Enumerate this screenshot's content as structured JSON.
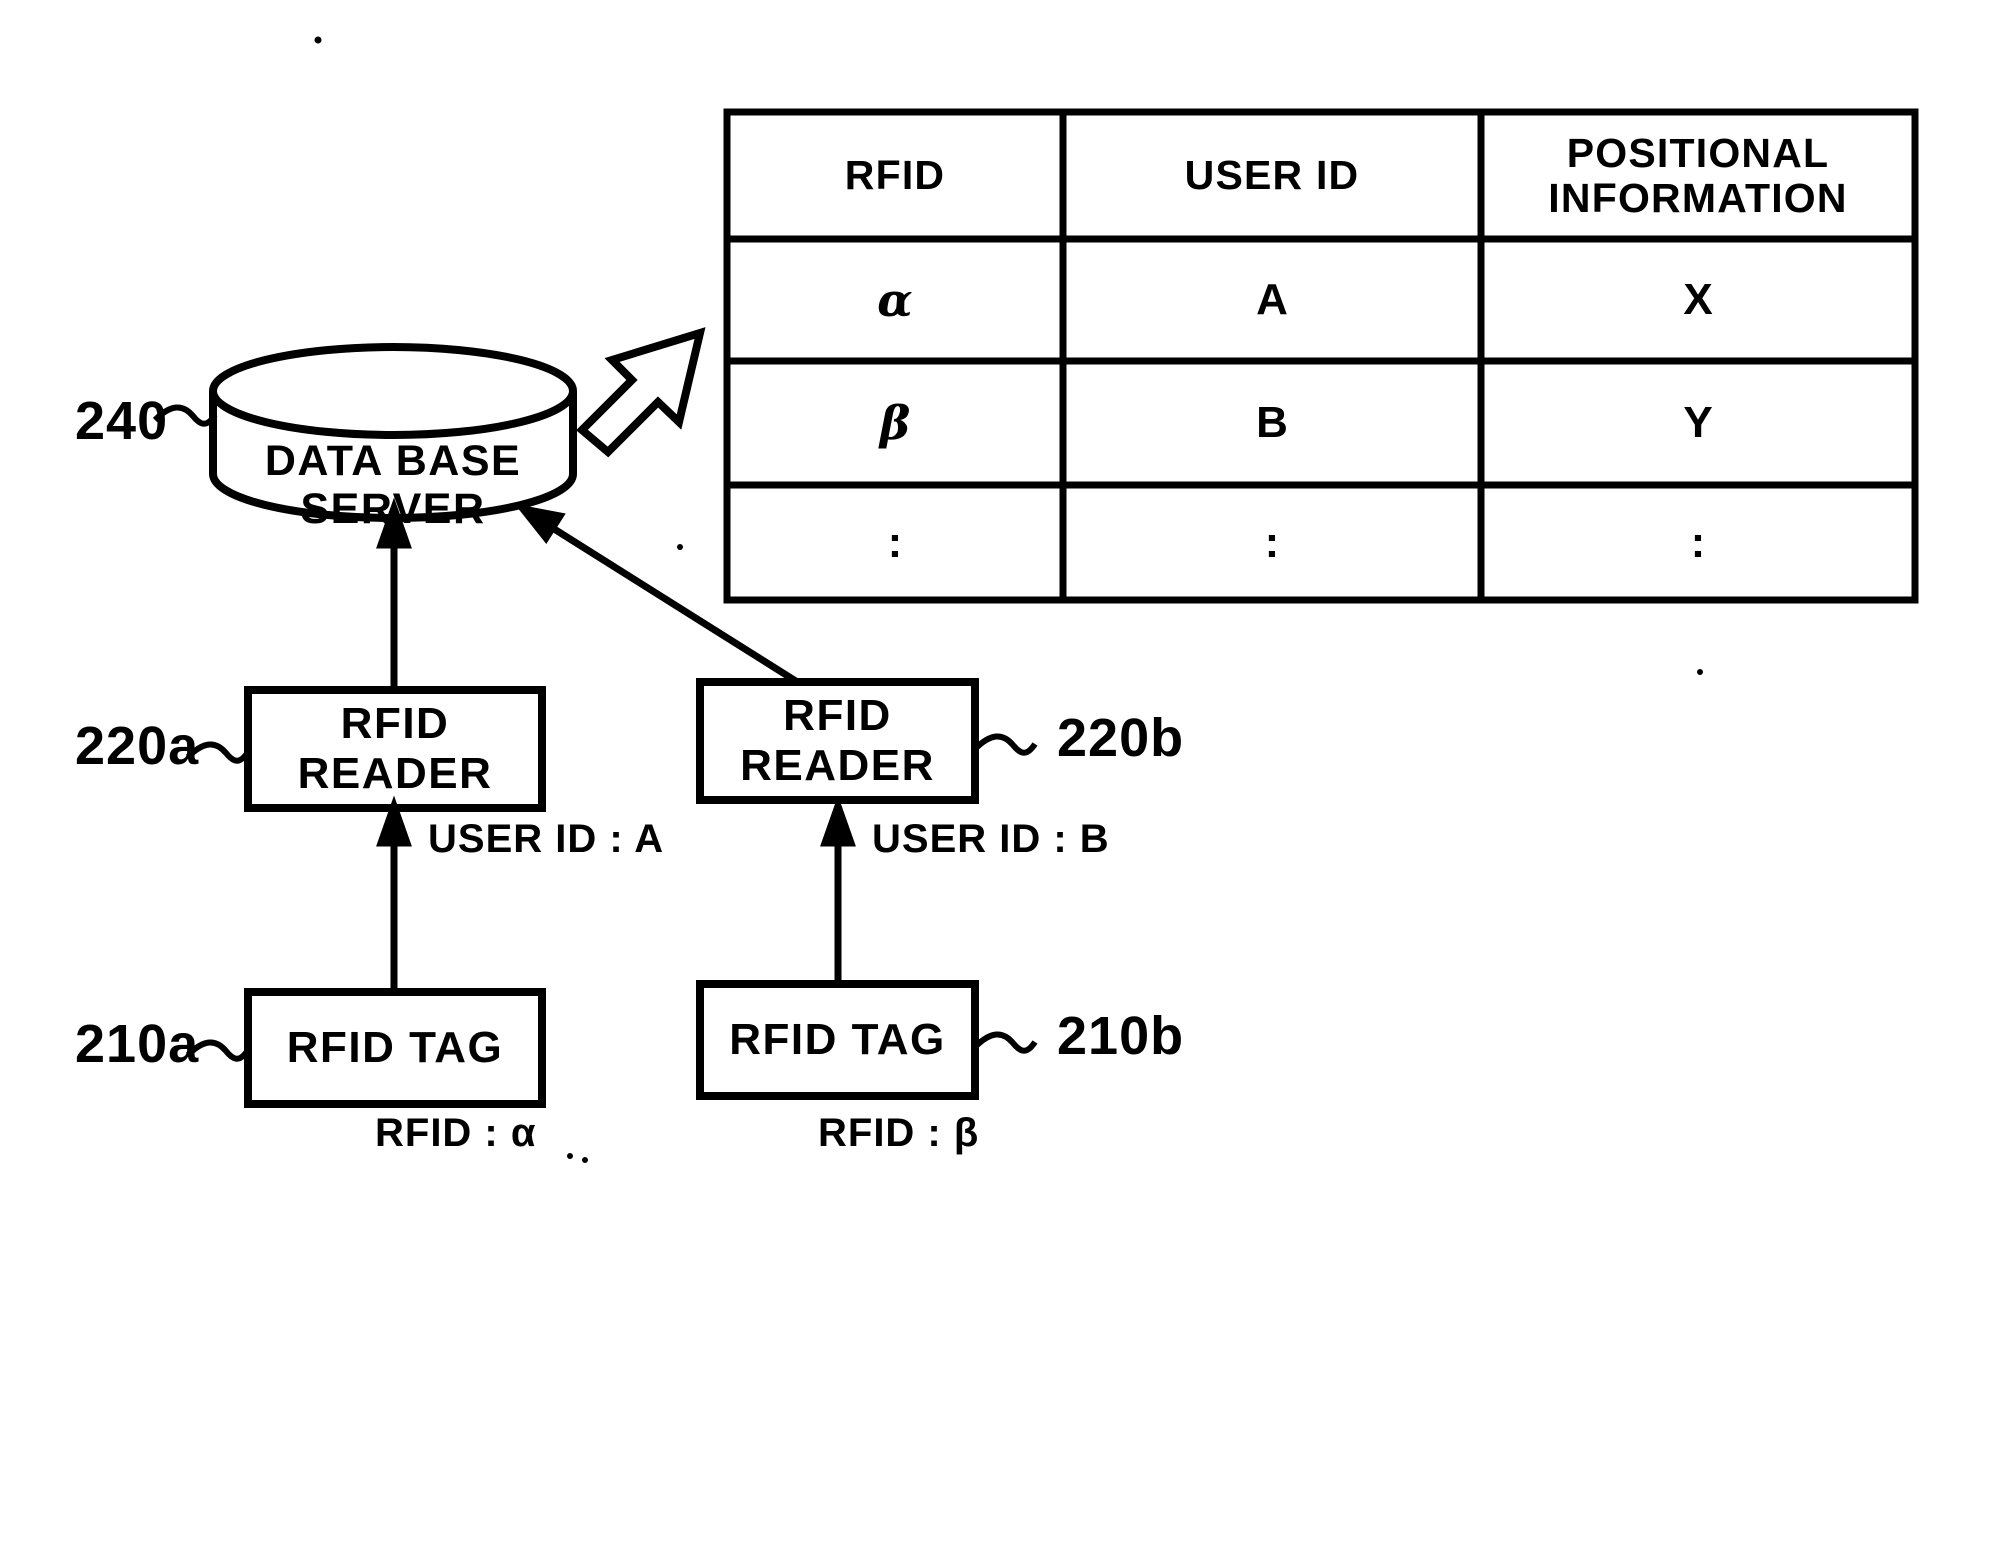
{
  "figure": {
    "kind": "patent-diagram",
    "ink_color": "#000000",
    "background_color": "#ffffff"
  },
  "table": {
    "headers": [
      "RFID",
      "USER ID",
      "POSITIONAL\nINFORMATION"
    ],
    "header_rfid": "RFID",
    "header_user_id": "USER ID",
    "header_positional_line1": "POSITIONAL",
    "header_positional_line2": "INFORMATION",
    "rows": [
      {
        "rfid": "α",
        "user_id": "A",
        "positional": "X"
      },
      {
        "rfid": "β",
        "user_id": "B",
        "positional": "Y"
      },
      {
        "rfid": ":",
        "user_id": ":",
        "positional": ":"
      }
    ]
  },
  "database": {
    "ref": "240",
    "label_line1": "DATA BASE",
    "label_line2": "SERVER"
  },
  "readers": [
    {
      "ref": "220a",
      "label": "RFID READER",
      "flow_label": "USER ID : A"
    },
    {
      "ref": "220b",
      "label": "RFID READER",
      "flow_label": "USER ID : B"
    }
  ],
  "tags": [
    {
      "ref": "210a",
      "label": "RFID TAG",
      "flow_label": "RFID : α"
    },
    {
      "ref": "210b",
      "label": "RFID TAG",
      "flow_label": "RFID : β"
    }
  ]
}
